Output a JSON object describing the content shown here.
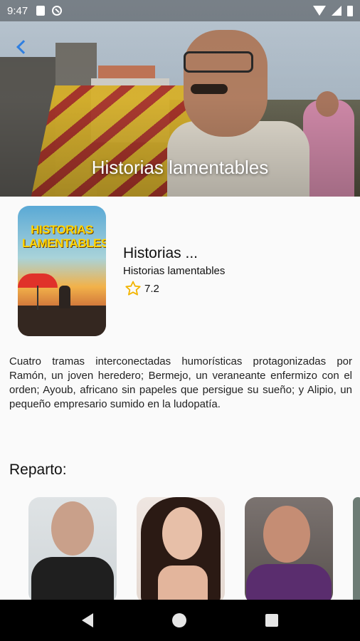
{
  "status_bar": {
    "time": "9:47"
  },
  "hero": {
    "title": "Historias lamentables"
  },
  "poster": {
    "title_text": "HISTORIAS LAMENTABLES"
  },
  "movie": {
    "title": "Historias ...",
    "original_title": "Historias lamentables",
    "rating": "7.2",
    "overview": "Cuatro tramas interconectadas humorísticas protagonizadas por Ramón, un joven heredero; Bermejo, un veraneante enfermizo con el orden; Ayoub, africano sin papeles que persigue su sueño; y Alipio, un pequeño empresario sumido en la ludopatía."
  },
  "cast": {
    "heading": "Reparto:"
  },
  "colors": {
    "accent": "#2f7fe0",
    "star": "#f2b400"
  },
  "icons": [
    "back-arrow-icon",
    "star-icon",
    "wifi-icon",
    "signal-icon",
    "battery-icon"
  ]
}
